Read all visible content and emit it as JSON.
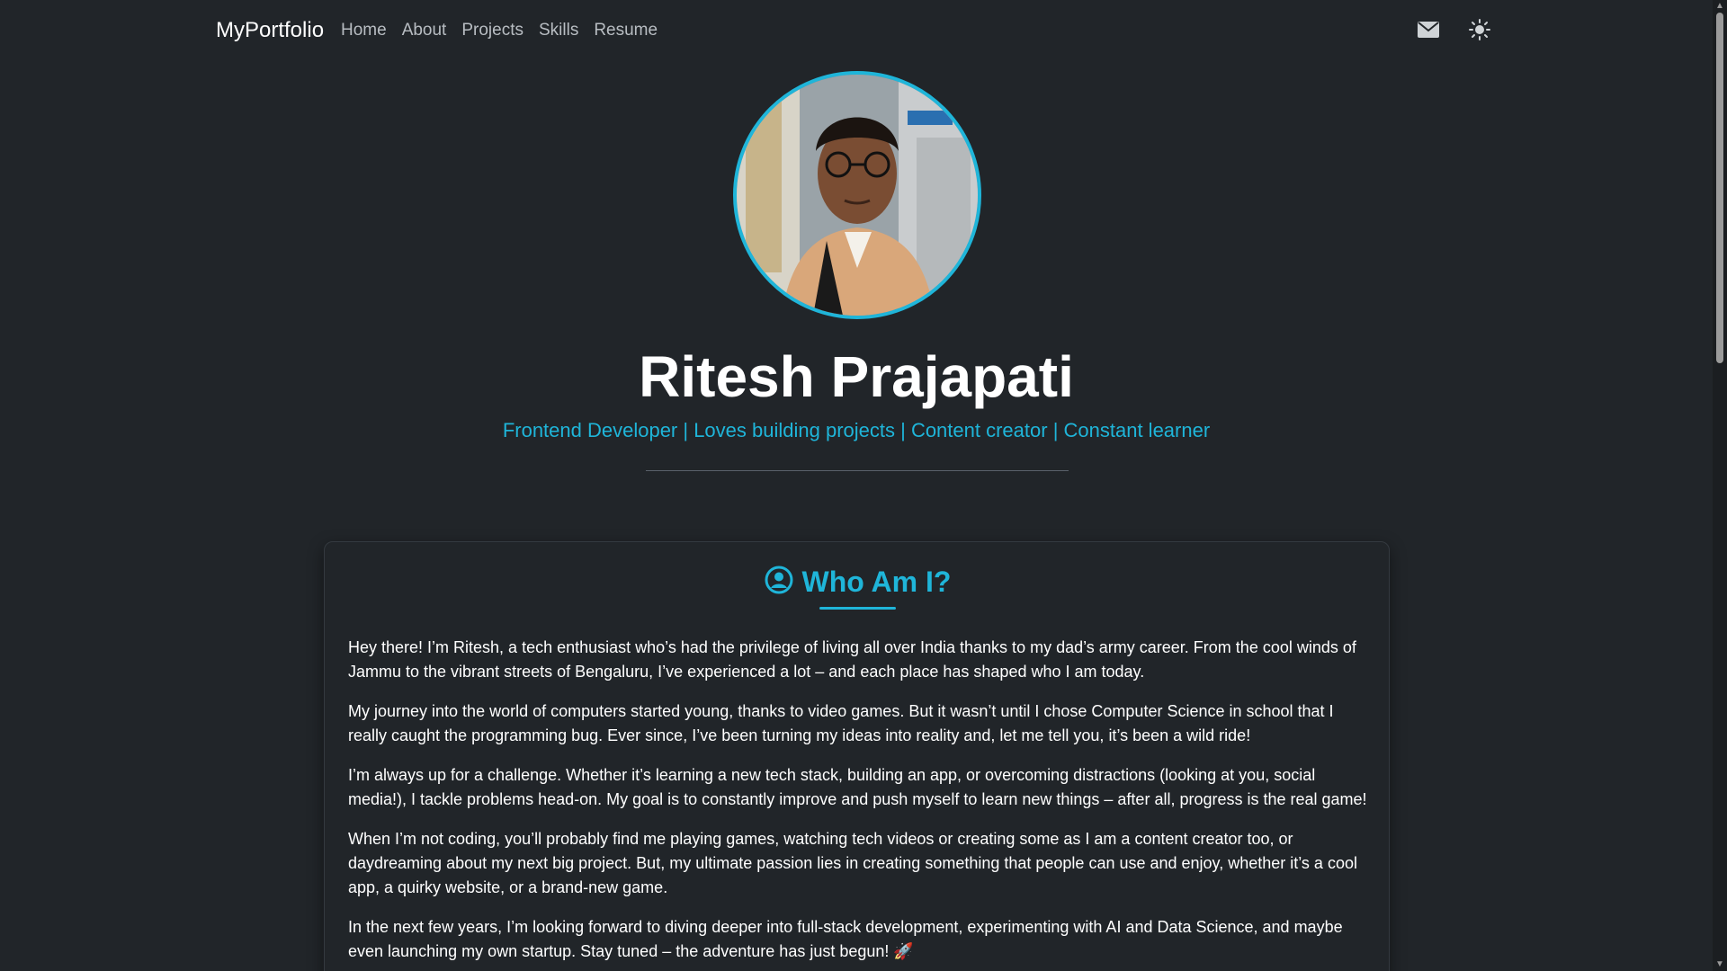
{
  "nav": {
    "brand": "MyPortfolio",
    "links": [
      "Home",
      "About",
      "Projects",
      "Skills",
      "Resume"
    ],
    "icons": [
      "envelope-icon",
      "sun-icon"
    ]
  },
  "hero": {
    "name": "Ritesh Prajapati",
    "tagline": "Frontend Developer | Loves building projects | Content creator | Constant learner"
  },
  "about": {
    "title": "Who Am I?",
    "icon": "user-circle-icon",
    "paragraphs": [
      "Hey there! I’m Ritesh, a tech enthusiast who’s had the privilege of living all over India thanks to my dad’s army career. From the cool winds of Jammu to the vibrant streets of Bengaluru, I’ve experienced a lot – and each place has shaped who I am today.",
      "My journey into the world of computers started young, thanks to video games. But it wasn’t until I chose Computer Science in school that I really caught the programming bug. Ever since, I’ve been turning my ideas into reality and, let me tell you, it’s been a wild ride!",
      "I’m always up for a challenge. Whether it’s learning a new tech stack, building an app, or overcoming distractions (looking at you, social media!), I tackle problems head-on. My goal is to constantly improve and push myself to learn new things – after all, progress is the real game!",
      "When I’m not coding, you’ll probably find me playing games, watching tech videos or creating some as I am a content creator too, or daydreaming about my next big project. But, my ultimate passion lies in creating something that people can use and enjoy, whether it’s a cool app, a quirky website, or a brand-new game.",
      "In the next few years, I’m looking forward to diving deeper into full-stack development, experimenting with AI and Data Science, and maybe even launching my own startup. Stay tuned – the adventure has just begun! 🚀"
    ]
  },
  "colors": {
    "background": "#212529",
    "accent": "#1fb5d9",
    "text": "#ffffff"
  }
}
